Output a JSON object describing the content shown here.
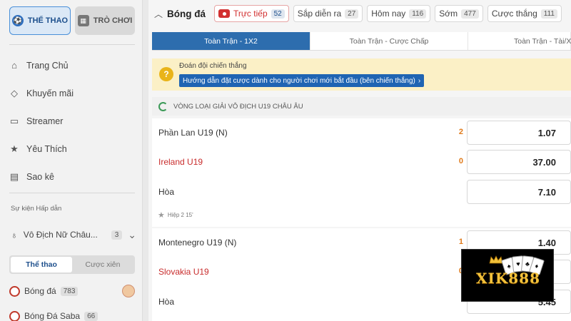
{
  "sidebar": {
    "top_tabs": [
      {
        "label": "Thể thao",
        "icon": "soccer-ball-icon"
      },
      {
        "label": "Trò chơi",
        "icon": "game-icon"
      }
    ],
    "nav": [
      {
        "label": "Trang Chủ",
        "icon": "home-icon"
      },
      {
        "label": "Khuyến mãi",
        "icon": "diamond-icon"
      },
      {
        "label": "Streamer",
        "icon": "tv-icon"
      },
      {
        "label": "Yêu Thích",
        "icon": "star-icon"
      },
      {
        "label": "Sao kê",
        "icon": "statement-icon"
      }
    ],
    "section_title": "Sự kiện Hấp dẫn",
    "event": {
      "label": "Vô Địch Nữ Châu...",
      "count": "3"
    },
    "segments": [
      "Thể thao",
      "Cược xiên"
    ],
    "sports": [
      {
        "label": "Bóng đá",
        "count": "783"
      },
      {
        "label": "Bóng Đá Saba",
        "count": "66"
      }
    ]
  },
  "header": {
    "title": "Bóng đá",
    "filters": [
      {
        "label": "Trực tiếp",
        "count": "52"
      },
      {
        "label": "Sắp diễn ra",
        "count": "27"
      },
      {
        "label": "Hôm nay",
        "count": "116"
      },
      {
        "label": "Sớm",
        "count": "477"
      },
      {
        "label": "Cược thắng",
        "count": "111"
      }
    ]
  },
  "market_tabs": [
    "Toàn Trận - 1X2",
    "Toàn Trận - Cược Chấp",
    "Toàn Trận - Tài/Xỉu"
  ],
  "promo": {
    "title": "Đoán đội chiến thắng",
    "button": "Hướng dẫn đặt cược dành cho người chơi mới bắt đầu (bên chiến thắng)"
  },
  "league": "VÒNG LOẠI GIẢI VÔ ĐỊCH U19 CHÂU ÂU",
  "matches": [
    {
      "home": "Phần Lan U19 (N)",
      "home_score": "2",
      "home_odds": "1.07",
      "away": "Ireland U19",
      "away_score": "0",
      "away_odds": "37.00",
      "draw": "Hòa",
      "draw_odds": "7.10",
      "time": "Hiệp 2 15'"
    },
    {
      "home": "Montenegro U19 (N)",
      "home_score": "1",
      "home_odds": "1.40",
      "away": "Slovakia U19",
      "away_score": "0",
      "away_odds": "",
      "draw": "Hòa",
      "draw_odds": "5.45"
    }
  ],
  "logo": {
    "text": "XIK888"
  }
}
